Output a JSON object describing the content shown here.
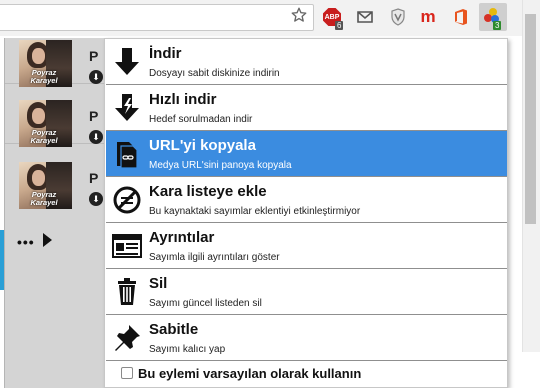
{
  "toolbar": {
    "bookmark_icon": "star-icon",
    "extensions": {
      "adblock": {
        "label": "ABP",
        "badge": "6"
      },
      "active_badge": "3",
      "office_color": "#e8541e",
      "m_letter": "m",
      "m_color": "#d9261c"
    }
  },
  "media_list": {
    "items": [
      {
        "thumb_title": "Poyraz Karayel",
        "letter": "P"
      },
      {
        "thumb_title": "Poyraz Karayel",
        "letter": "P"
      },
      {
        "thumb_title": "Poyraz Karayel",
        "letter": "P"
      }
    ],
    "more_label": "•••"
  },
  "context_menu": {
    "items": [
      {
        "title": "İndir",
        "description": "Dosyayı sabit diskinize indirin",
        "icon": "download-arrow-icon"
      },
      {
        "title": "Hızlı indir",
        "description": "Hedef sorulmadan indir",
        "icon": "lightning-download-icon"
      },
      {
        "title": "URL'yi kopyala",
        "description": "Medya URL'sini panoya kopyala",
        "icon": "copy-url-icon",
        "highlighted": true
      },
      {
        "title": "Kara listeye ekle",
        "description": "Bu kaynaktaki sayımlar eklentiyi etkinleştirmiyor",
        "icon": "blacklist-icon"
      },
      {
        "title": "Ayrıntılar",
        "description": "Sayımla ilgili ayrıntıları göster",
        "icon": "details-icon"
      },
      {
        "title": "Sil",
        "description": "Sayımı güncel listeden sil",
        "icon": "trash-icon"
      },
      {
        "title": "Sabitle",
        "description": "Sayımı kalıcı yap",
        "icon": "pin-icon"
      }
    ],
    "default_action_label": "Bu eylemi varsayılan olarak kullanın",
    "default_action_checked": false
  },
  "colors": {
    "highlight": "#3b8ce0",
    "page_accent": "#2a9fd6"
  }
}
